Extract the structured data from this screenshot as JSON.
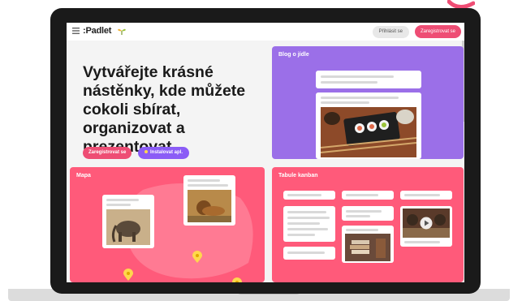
{
  "header": {
    "brand": ":Padlet",
    "login_label": "Přihlásit se",
    "signup_label": "Zaregistrovat se"
  },
  "hero": {
    "headline": "Vytvářejte krásné nástěnky, kde můžete cokoli sbírat, organizovat a prezentovat.",
    "signup_label": "Zaregistrovat se",
    "install_label": "Instalovat apl."
  },
  "cards": {
    "blog": {
      "title": "Blog o jídle"
    },
    "map": {
      "title": "Mapa"
    },
    "kanban": {
      "title": "Tabule kanban"
    }
  },
  "icons": [
    "menu-icon",
    "leaf-icon",
    "map-pin-icon",
    "play-icon"
  ],
  "colors": {
    "accent_pink": "#ee4d74",
    "card_pink": "#ff5a7a",
    "card_purple": "#9b6fe8",
    "install_purple": "#8b5cf6"
  }
}
